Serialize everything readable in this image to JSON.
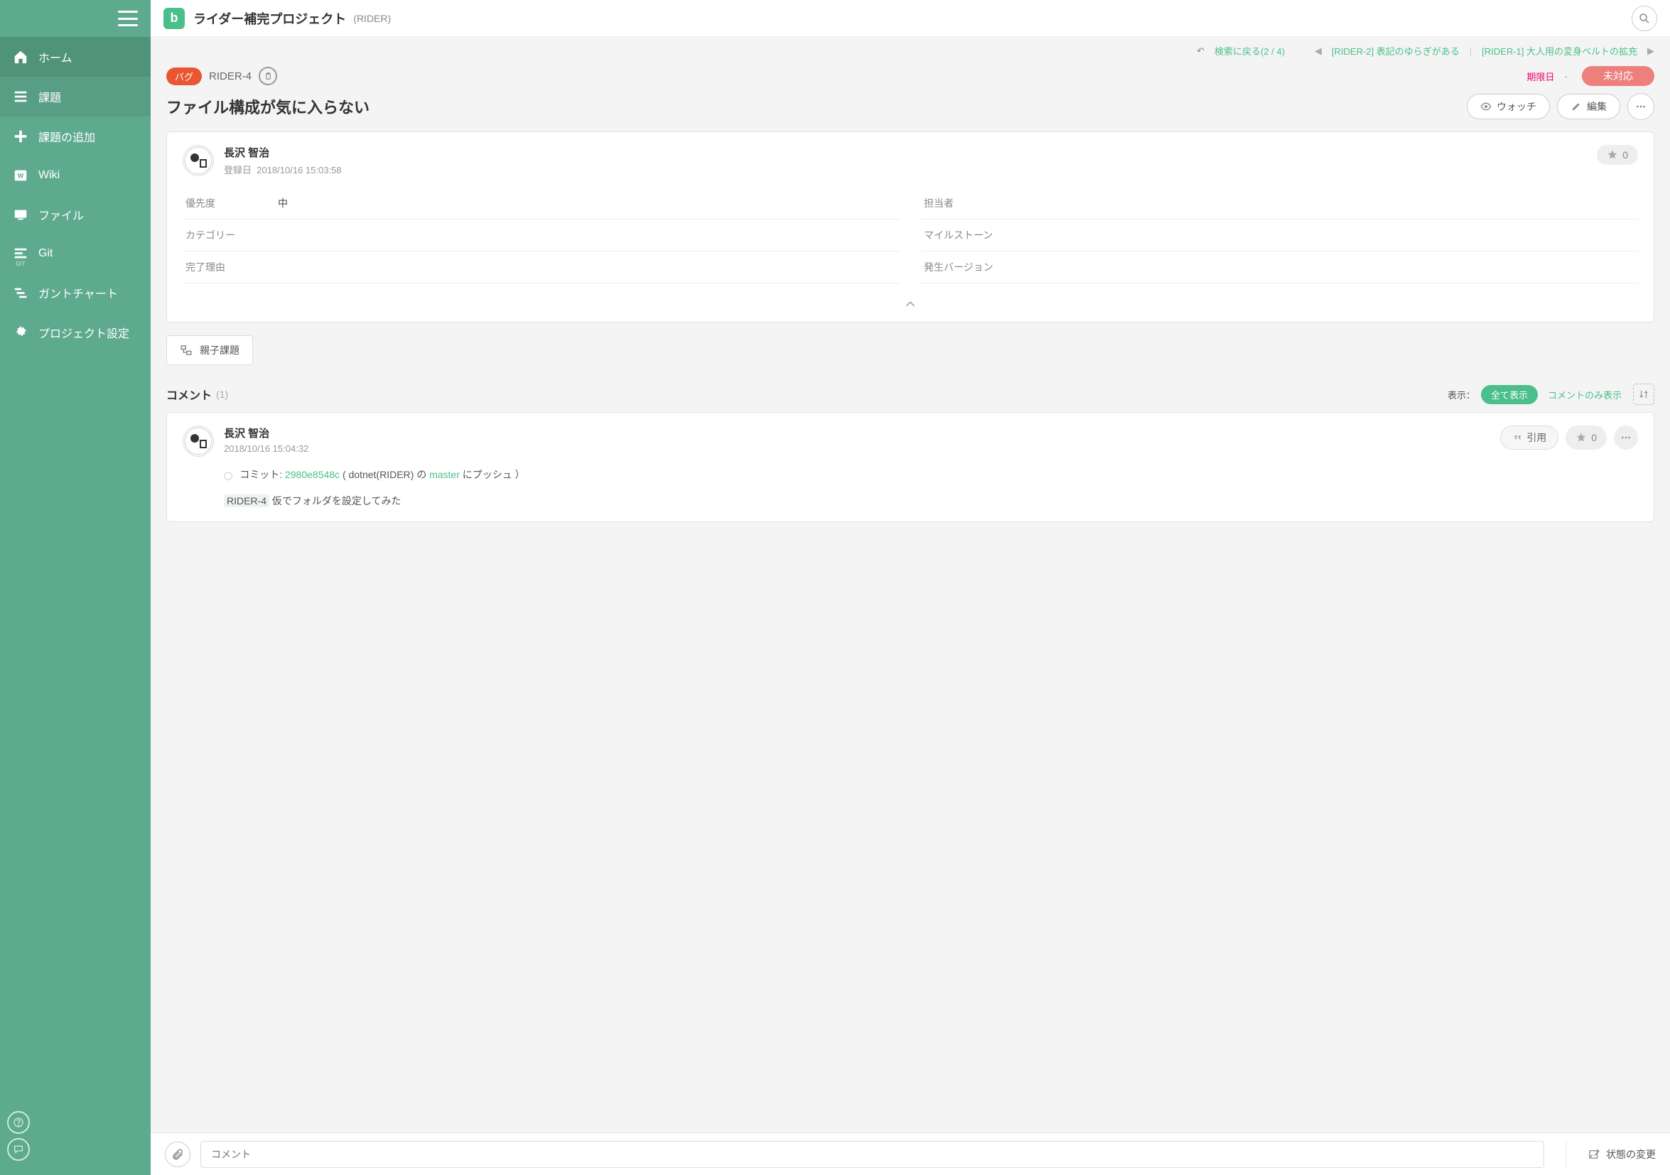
{
  "sidebar": {
    "items": [
      {
        "label": "ホーム"
      },
      {
        "label": "課題"
      },
      {
        "label": "課題の追加"
      },
      {
        "label": "Wiki"
      },
      {
        "label": "ファイル"
      },
      {
        "label": "Git"
      },
      {
        "label": "ガントチャート"
      },
      {
        "label": "プロジェクト設定"
      }
    ]
  },
  "project": {
    "name": "ライダー補完プロジェクト",
    "key": "(RIDER)",
    "logo": "b"
  },
  "nav": {
    "back_to_search": "検索に戻る(2 / 4)",
    "prev_issue": "[RIDER-2] 表記のゆらぎがある",
    "next_issue": "[RIDER-1] 大人用の変身ベルトの拡充"
  },
  "issue": {
    "type_chip": "バグ",
    "key": "RIDER-4",
    "due_label": "期限日",
    "due_value": "-",
    "status": "未対応",
    "title": "ファイル構成が気に入らない",
    "watch_btn": "ウォッチ",
    "edit_btn": "編集",
    "author_name": "長沢 智治",
    "registered_label": "登録日",
    "registered_at": "2018/10/16 15:03:58",
    "star_count": "0",
    "fields_left": [
      {
        "label": "優先度",
        "value": "中"
      },
      {
        "label": "カテゴリー",
        "value": ""
      },
      {
        "label": "完了理由",
        "value": ""
      }
    ],
    "fields_right": [
      {
        "label": "担当者",
        "value": ""
      },
      {
        "label": "マイルストーン",
        "value": ""
      },
      {
        "label": "発生バージョン",
        "value": ""
      }
    ],
    "subtask_btn": "親子課題"
  },
  "comments": {
    "title": "コメント",
    "count": "(1)",
    "show_label": "表示：",
    "show_all": "全て表示",
    "show_comments_only": "コメントのみ表示",
    "items": [
      {
        "author": "長沢 智治",
        "at": "2018/10/16 15:04:32",
        "quote_btn": "引用",
        "star": "0",
        "body_prefix": "コミット: ",
        "commit_hash": "2980e8548c",
        "body_mid1": " ( dotnet(RIDER) の ",
        "branch": "master",
        "body_mid2": " にプッシュ ）",
        "line2_tag": "RIDER-4",
        "line2_text": " 仮でフォルダを設定してみた"
      }
    ]
  },
  "footer": {
    "comment_placeholder": "コメント",
    "status_change": "状態の変更"
  }
}
